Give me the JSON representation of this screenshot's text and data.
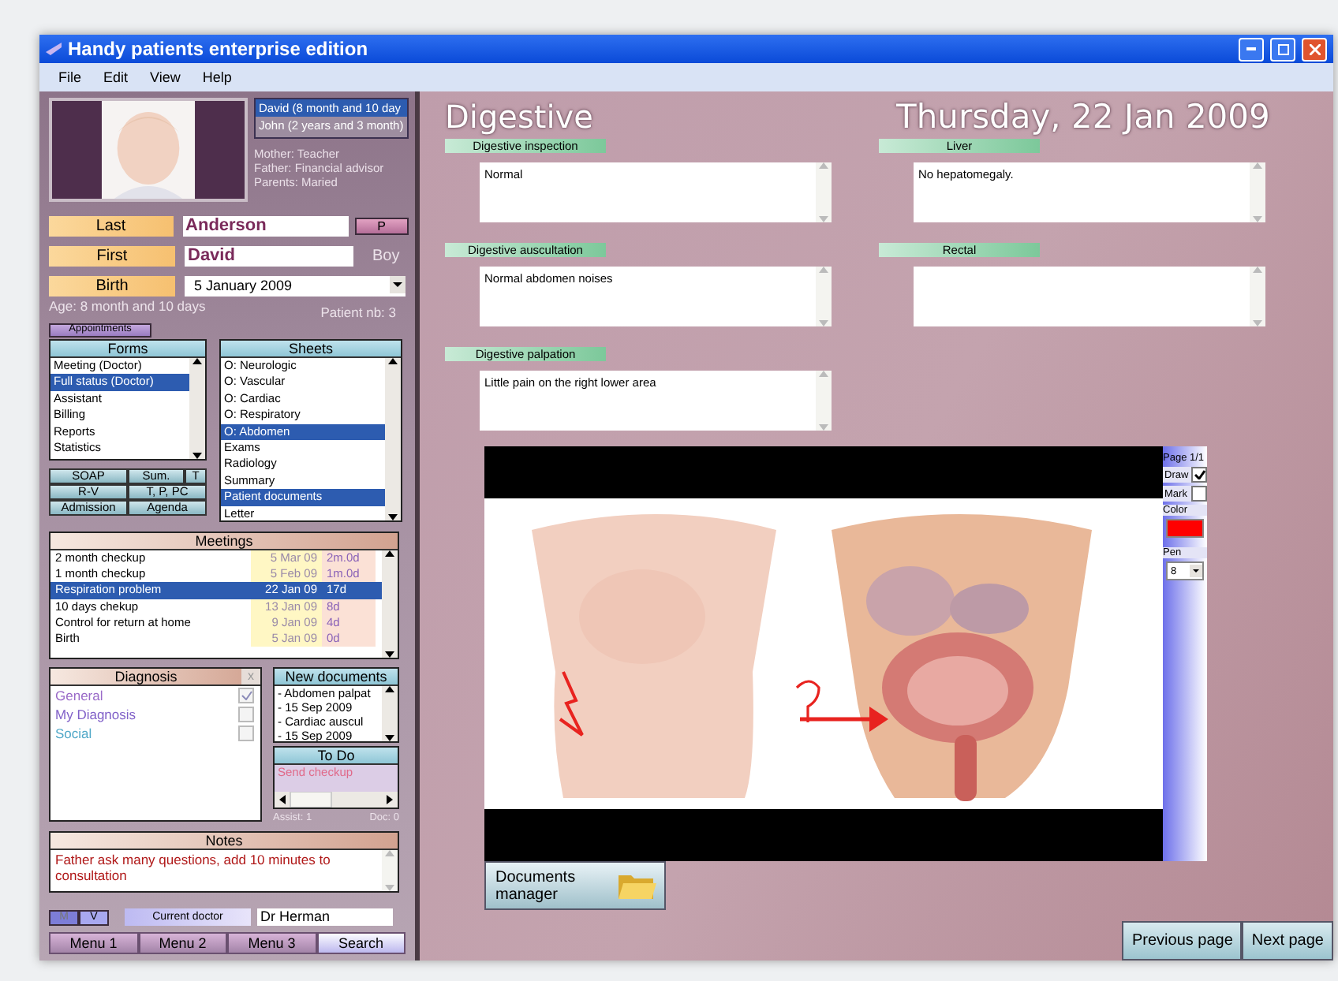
{
  "window": {
    "title": "Handy patients enterprise edition"
  },
  "menu": [
    "File",
    "Edit",
    "View",
    "Help"
  ],
  "patient": {
    "children": [
      {
        "label": "David  (8 month and 10 day",
        "selected": true
      },
      {
        "label": "John  (2 years and 3 month)",
        "selected": false
      }
    ],
    "family": [
      "Mother: Teacher",
      "Father: Financial advisor",
      "Parents: Maried"
    ],
    "fields": [
      {
        "kind": "text",
        "label": "Last",
        "value": "Anderson"
      },
      {
        "kind": "text",
        "label": "First",
        "value": "David"
      },
      {
        "kind": "date",
        "label": "Birth",
        "value": "5  January  2009"
      }
    ],
    "p_button": "P",
    "sex": "Boy",
    "age": "Age: 8 month and 10 days",
    "number": "Patient nb: 3"
  },
  "appointments_button": "Appointments",
  "forms": {
    "title": "Forms",
    "items": [
      {
        "label": "Meeting (Doctor)",
        "selected": false
      },
      {
        "label": "Full status (Doctor)",
        "selected": true
      },
      {
        "label": "Assistant",
        "selected": false
      },
      {
        "label": "Billing",
        "selected": false
      },
      {
        "label": "Reports",
        "selected": false
      },
      {
        "label": "Statistics",
        "selected": false
      }
    ]
  },
  "sheets": {
    "title": "Sheets",
    "items": [
      {
        "label": "O: Neurologic",
        "selected": false
      },
      {
        "label": "O: Vascular",
        "selected": false
      },
      {
        "label": "O: Cardiac",
        "selected": false
      },
      {
        "label": "O: Respiratory",
        "selected": false
      },
      {
        "label": "O: Abdomen",
        "selected": true
      },
      {
        "label": "Exams",
        "selected": false
      },
      {
        "label": "Radiology",
        "selected": false
      },
      {
        "label": "Summary",
        "selected": false
      },
      {
        "label": "Patient documents",
        "selected": true
      },
      {
        "label": "Letter",
        "selected": false
      }
    ]
  },
  "quick_buttons": [
    [
      "SOAP",
      "Sum.",
      "T"
    ],
    [
      "R-V",
      "T, P, PC"
    ],
    [
      "Admission",
      "Agenda"
    ]
  ],
  "meetings": {
    "title": "Meetings",
    "rows": [
      {
        "name": "2 month checkup",
        "date": "5 Mar 09",
        "age": "2m.0d",
        "selected": false
      },
      {
        "name": "1 month checkup",
        "date": "5 Feb 09",
        "age": "1m.0d",
        "selected": false
      },
      {
        "name": "Respiration problem",
        "date": "22 Jan 09",
        "age": "17d",
        "selected": true
      },
      {
        "name": "10 days chekup",
        "date": "13 Jan 09",
        "age": "8d",
        "selected": false
      },
      {
        "name": "Control for return at home",
        "date": "9 Jan 09",
        "age": "4d",
        "selected": false
      },
      {
        "name": "Birth",
        "date": "5 Jan 09",
        "age": "0d",
        "selected": false
      }
    ]
  },
  "diagnosis": {
    "title": "Diagnosis",
    "close": "x",
    "items": [
      {
        "label": "General",
        "checked": true,
        "color": "#9a6ac8"
      },
      {
        "label": "My Diagnosis",
        "checked": false,
        "color": "#8060c8"
      },
      {
        "label": "Social",
        "checked": false,
        "color": "#50a8c8"
      }
    ]
  },
  "new_documents": {
    "title": "New documents",
    "items": [
      "- Abdomen palpat",
      "- 15 Sep 2009",
      "- Cardiac auscul",
      "- 15 Sep 2009"
    ]
  },
  "todo": {
    "title": "To Do",
    "items": [
      "Send checkup"
    ]
  },
  "counts": [
    "Assist: 1",
    "Doc: 0"
  ],
  "notes": {
    "title": "Notes",
    "text": "Father ask many questions, add 10 minutes to consultation"
  },
  "mode_buttons": [
    {
      "label": "M",
      "selected": false
    },
    {
      "label": "V",
      "selected": true
    }
  ],
  "doctor": {
    "label": "Current doctor",
    "value": "Dr Herman"
  },
  "tabs": [
    {
      "label": "Menu 1",
      "selected": false
    },
    {
      "label": "Menu 2",
      "selected": false
    },
    {
      "label": "Menu 3",
      "selected": false
    },
    {
      "label": "Search",
      "selected": true
    }
  ],
  "sheet": {
    "title": "Digestive",
    "date": "Thursday, 22 Jan 2009",
    "left_sections": [
      {
        "label": "Digestive inspection",
        "value": "Normal"
      },
      {
        "label": "Digestive auscultation",
        "value": "Normal abdomen noises"
      },
      {
        "label": "Digestive palpation",
        "value": "Little pain on the right lower area"
      }
    ],
    "right_sections": [
      {
        "label": "Liver",
        "value": "No hepatomegaly."
      },
      {
        "label": "Rectal"
      }
    ]
  },
  "viewer": {
    "page": "Page 1/1",
    "options": [
      {
        "label": "Draw",
        "checked": true
      },
      {
        "label": "Mark",
        "checked": false
      }
    ],
    "color_label": "Color",
    "color": "#ff0000",
    "pen_label": "Pen",
    "pen": "8"
  },
  "documents_button": "Documents manager",
  "nav": [
    "Previous page",
    "Next page"
  ]
}
